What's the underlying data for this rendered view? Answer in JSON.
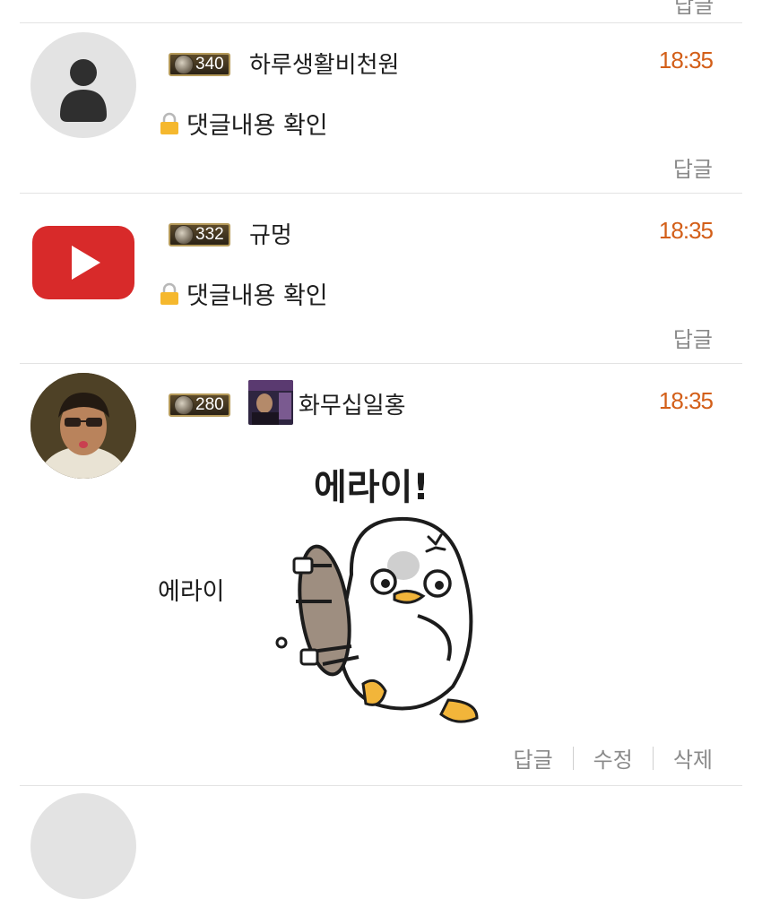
{
  "top": {
    "reply_label": "답글"
  },
  "comments": [
    {
      "level": "340",
      "nickname": "하루생활비천원",
      "time": "18:35",
      "body": "댓글내용 확인",
      "reply_label": "답글"
    },
    {
      "level": "332",
      "nickname": "규멍",
      "time": "18:35",
      "body": "댓글내용 확인",
      "reply_label": "답글"
    },
    {
      "level": "280",
      "nickname": "화무십일홍",
      "time": "18:35",
      "body": "에라이",
      "sticker_text": "에라이!",
      "reply_label": "답글",
      "edit_label": "수정",
      "delete_label": "삭제"
    }
  ],
  "colors": {
    "time": "#d35f19",
    "muted": "#8a8a8a",
    "divider": "#e3e3e3"
  }
}
